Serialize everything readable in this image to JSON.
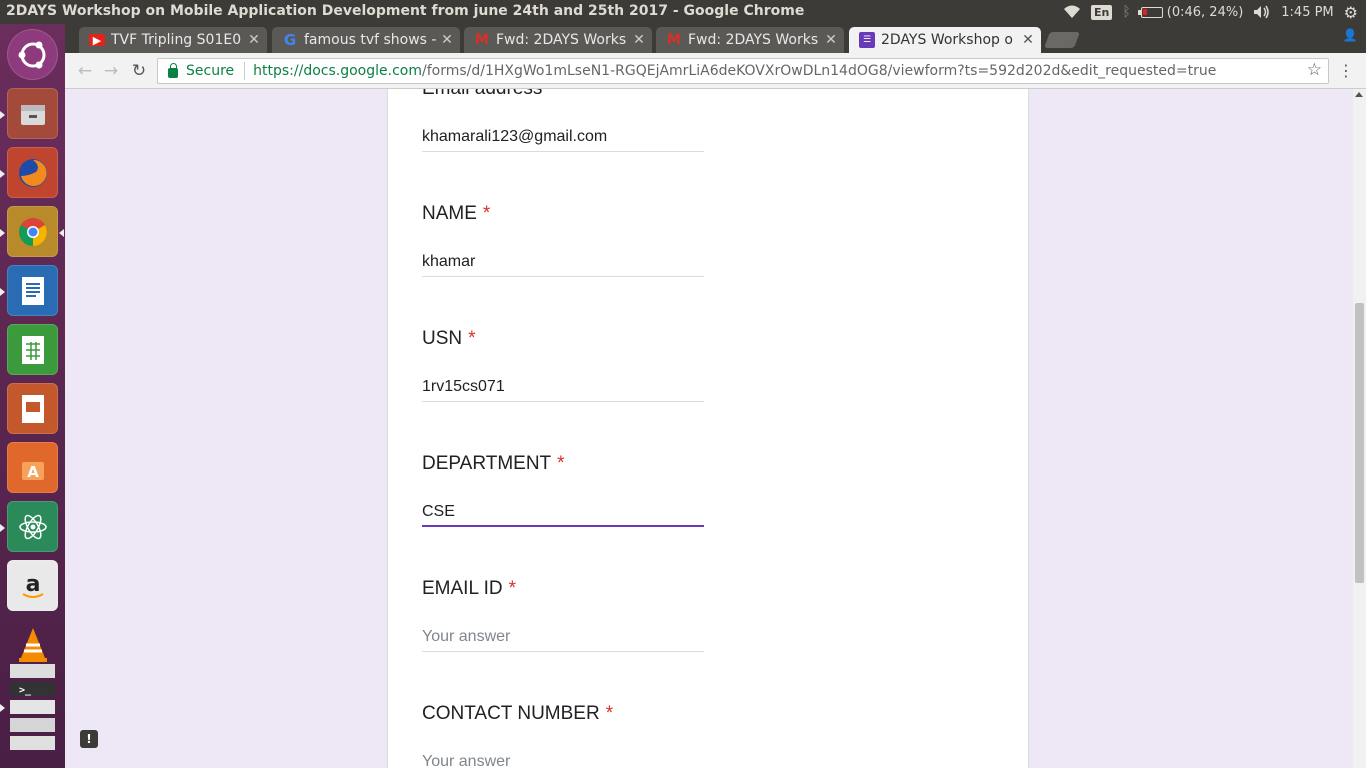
{
  "window": {
    "title": "2DAYS Workshop on Mobile Application Development from june 24th and 25th 2017 - Google Chrome"
  },
  "panel": {
    "lang": "En",
    "battery": "(0:46, 24%)",
    "time": "1:45 PM"
  },
  "tabs": [
    {
      "label": "TVF Tripling S01E0",
      "favicon": "youtube-icon",
      "color": "#e62117"
    },
    {
      "label": "famous tvf shows -",
      "favicon": "google-icon",
      "color": "#4285f4"
    },
    {
      "label": "Fwd: 2DAYS Works",
      "favicon": "gmail-icon",
      "color": "#d93025"
    },
    {
      "label": "Fwd: 2DAYS Works",
      "favicon": "gmail-icon",
      "color": "#d93025"
    },
    {
      "label": "2DAYS Workshop o",
      "favicon": "forms-icon",
      "color": "#673ab7"
    }
  ],
  "toolbar": {
    "secure": "Secure",
    "url_host": "https://docs.google.com",
    "url_rest": "/forms/d/1HXgWo1mLseN1-RGQEjAmrLiA6deKOVXrOwDLn14dOG8/viewform?ts=592d202d&edit_requested=true"
  },
  "form": {
    "email_label": "Email address",
    "email_value": "khamarali123@gmail.com",
    "questions": [
      {
        "label": "NAME",
        "value": "khamar"
      },
      {
        "label": "USN",
        "value": "1rv15cs071"
      },
      {
        "label": "DEPARTMENT",
        "value": "CSE"
      },
      {
        "label": "EMAIL ID",
        "placeholder": "Your answer"
      },
      {
        "label": "CONTACT NUMBER",
        "placeholder": "Your answer"
      }
    ],
    "required_mark": "*"
  },
  "colors": {
    "accent": "#673ab7",
    "required": "#d93025",
    "background": "#ede7f6"
  }
}
